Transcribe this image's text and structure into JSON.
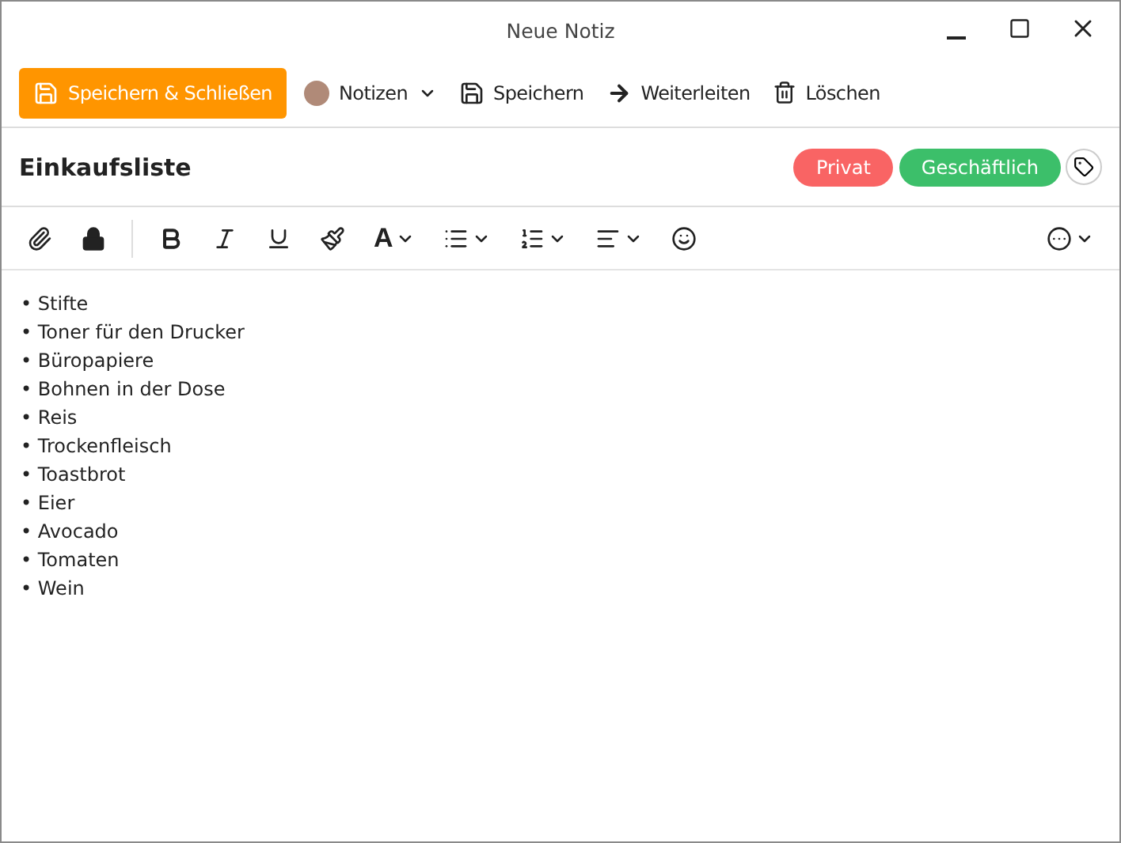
{
  "window": {
    "title": "Neue Notiz"
  },
  "toolbar": [
    {
      "kind": "primary",
      "label": "Speichern & Schließen"
    },
    {
      "kind": "avatar",
      "label": "Notizen"
    },
    {
      "kind": "save",
      "label": "Speichern"
    },
    {
      "kind": "forward",
      "label": "Weiterleiten"
    },
    {
      "kind": "delete",
      "label": "Löschen"
    }
  ],
  "subject": "Einkaufsliste",
  "tags": [
    {
      "label": "Privat",
      "color": "#f96464"
    },
    {
      "label": "Geschäftlich",
      "color": "#3cbf6a"
    }
  ],
  "font_color_button": {
    "label": "A"
  },
  "body": [
    "• Stifte",
    "• Toner für den Drucker",
    "• Büropapiere",
    "• Bohnen in der Dose",
    "• Reis",
    "• Trockenfleisch",
    "• Toastbrot",
    "• Eier",
    "• Avocado",
    "• Tomaten",
    "• Wein"
  ]
}
